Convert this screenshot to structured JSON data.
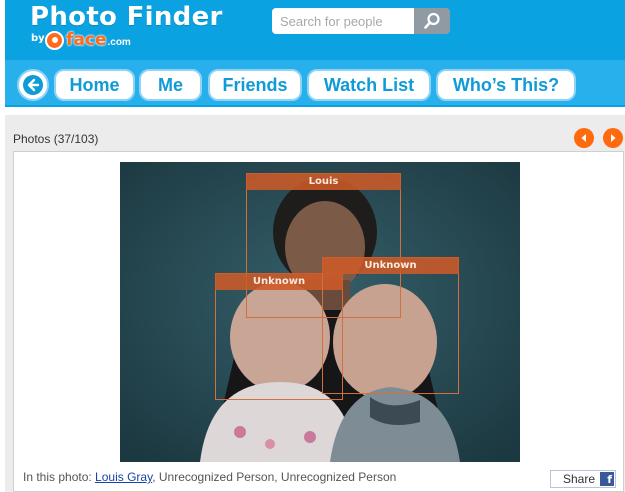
{
  "app": {
    "title": "Photo Finder",
    "byline": "by",
    "brand": "face",
    "brand_suffix": ".com"
  },
  "search": {
    "placeholder": "Search for people",
    "value": ""
  },
  "nav": {
    "items": [
      {
        "label": "Home"
      },
      {
        "label": "Me"
      },
      {
        "label": "Friends"
      },
      {
        "label": "Watch List"
      },
      {
        "label": "Who’s This?"
      }
    ]
  },
  "photos": {
    "heading": "Photos (37/103)"
  },
  "tags": [
    {
      "label": "Louis"
    },
    {
      "label": "Unknown"
    },
    {
      "label": "Unknown"
    }
  ],
  "caption": {
    "prefix": "In this photo: ",
    "person_link": "Louis Gray",
    "rest": ", Unrecognized Person, Unrecognized Person"
  },
  "share": {
    "label": "Share",
    "fb_glyph": "f"
  },
  "colors": {
    "header_blue": "#0aa2e0",
    "nav_strip": "#28b0ec",
    "accent_orange": "#ff6a0e",
    "tag_orange": "#cd5a28"
  }
}
